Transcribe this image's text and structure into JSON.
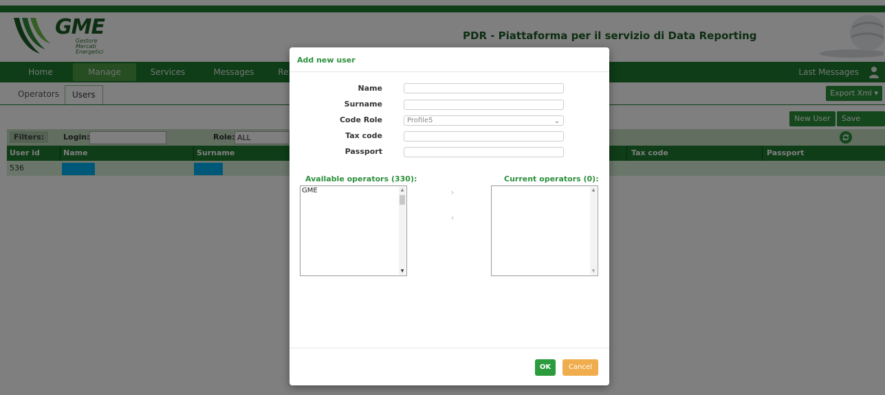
{
  "header": {
    "logo": {
      "word": "GME",
      "sub_lines": [
        "Gestore",
        "Mercati",
        "Energetici"
      ]
    },
    "title": "PDR - Piattaforma per il servizio di Data Reporting"
  },
  "nav": {
    "items": [
      "Home",
      "Manage",
      "Services",
      "Messages",
      "Re"
    ],
    "active": "Manage",
    "right_label": "Last Messages"
  },
  "subtabs": {
    "items": [
      "Operators",
      "Users"
    ],
    "active": "Users",
    "export_label": "Export Xml"
  },
  "toolbar": {
    "new_user_label": "New User",
    "save_users_label": "Save Users"
  },
  "filters": {
    "label": "Filters:",
    "login_label": "Login:",
    "login_value": "",
    "role_label": "Role:",
    "role_value": "ALL"
  },
  "grid": {
    "columns": [
      "User id",
      "Name",
      "Surname",
      "Tax code",
      "Passport"
    ],
    "rows": [
      {
        "user_id": "536",
        "name": "",
        "surname": "",
        "tax_code": "",
        "passport": ""
      }
    ],
    "colors": {
      "header": "#1d7a2e",
      "row": "#d6ecd4",
      "redacted": "#00b0f0"
    }
  },
  "modal": {
    "title": "Add new user",
    "fields": {
      "name_label": "Name",
      "name_value": "",
      "surname_label": "Surname",
      "surname_value": "",
      "code_role_label": "Code Role",
      "code_role_value": "Profile5",
      "tax_code_label": "Tax code",
      "tax_code_value": "",
      "passport_label": "Passport",
      "passport_value": ""
    },
    "available": {
      "title": "Available operators (330):",
      "items": [
        "GME"
      ]
    },
    "current": {
      "title": "Current operators (0):",
      "items": []
    },
    "move_right": "›",
    "move_left": "‹",
    "ok_label": "OK",
    "cancel_label": "Cancel"
  },
  "colors": {
    "brand_green": "#1d7a2e",
    "accent_green": "#2b8f3b",
    "cancel_orange": "#f0ad4e"
  }
}
